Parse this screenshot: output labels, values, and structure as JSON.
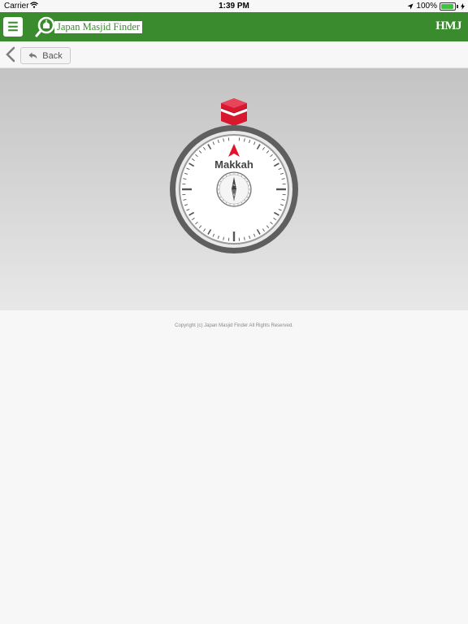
{
  "status_bar": {
    "carrier": "Carrier",
    "time": "1:39 PM",
    "battery": "100%"
  },
  "header": {
    "app_title": "Japan Masjid Finder",
    "brand_logo": "HMJ",
    "menu_icon": "hamburger-menu-icon",
    "color": "#3a8a2e"
  },
  "nav": {
    "back_label": "Back",
    "back_icon": "reply-arrow-icon",
    "chevron_icon": "chevron-left-icon"
  },
  "compass": {
    "target_label": "Makkah",
    "kaaba_icon": "kaaba-icon",
    "pointer_color": "#e0142b",
    "inner_letters": {
      "north": "N",
      "south": "S"
    }
  },
  "footer": {
    "copyright": "Copyright (c) Japan Masjid Finder All Rights Reserved."
  }
}
